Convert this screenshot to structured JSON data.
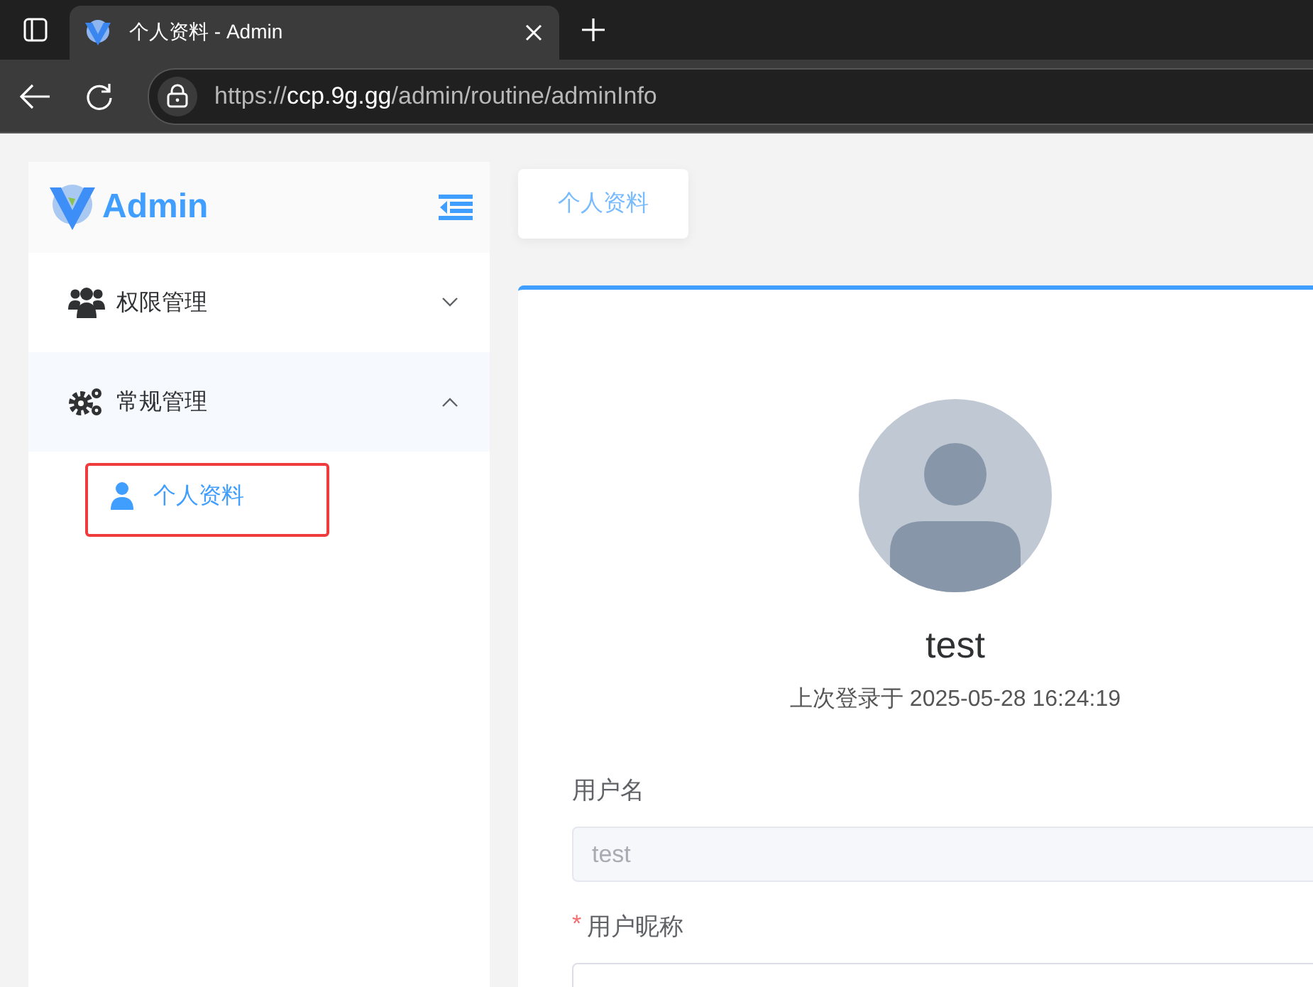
{
  "browser": {
    "tab_title": "个人资料 - Admin",
    "url": {
      "scheme": "https://",
      "host": "ccp.9g.gg",
      "path": "/admin/routine/adminInfo"
    }
  },
  "sidebar": {
    "logo_text": "Admin",
    "items": [
      {
        "label": "权限管理",
        "expanded": false
      },
      {
        "label": "常规管理",
        "expanded": true,
        "children": [
          {
            "label": "个人资料",
            "selected": true,
            "outlined": true
          }
        ]
      }
    ]
  },
  "tabs": [
    {
      "label": "个人资料",
      "selected": true
    }
  ],
  "profile": {
    "name": "test",
    "last_login": "上次登录于 2025-05-28 16:24:19"
  },
  "form": [
    {
      "label": "用户名",
      "value": "test",
      "disabled": true
    },
    {
      "label": "用户昵称",
      "required_mark": "*"
    }
  ]
}
